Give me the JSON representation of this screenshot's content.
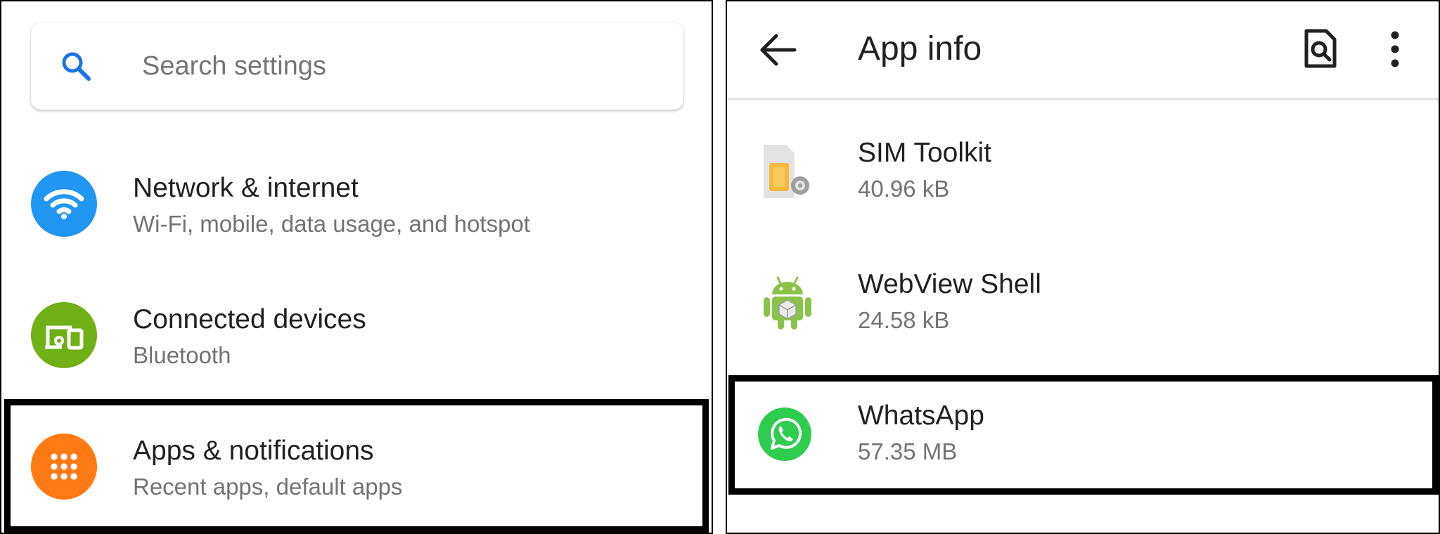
{
  "left_panel": {
    "search": {
      "placeholder": "Search settings",
      "icon": "search-icon",
      "icon_color": "#1a73e8"
    },
    "items": [
      {
        "title": "Network & internet",
        "subtitle": "Wi-Fi, mobile, data usage, and hotspot",
        "icon": "wifi-icon",
        "icon_color": "#2196f3"
      },
      {
        "title": "Connected devices",
        "subtitle": "Bluetooth",
        "icon": "devices-icon",
        "icon_color": "#6eb016"
      },
      {
        "title": "Apps & notifications",
        "subtitle": "Recent apps, default apps",
        "icon": "apps-grid-icon",
        "icon_color": "#ff7a14",
        "highlighted": true
      }
    ]
  },
  "right_panel": {
    "app_bar": {
      "title": "App info",
      "back_icon": "back-arrow-icon",
      "search_icon": "document-search-icon",
      "menu_icon": "more-vert-icon"
    },
    "apps": [
      {
        "name": "SIM Toolkit",
        "size": "40.96 kB",
        "icon": "sim-toolkit-icon"
      },
      {
        "name": "WebView Shell",
        "size": "24.58 kB",
        "icon": "android-webview-icon"
      },
      {
        "name": "WhatsApp",
        "size": "57.35 MB",
        "icon": "whatsapp-icon",
        "icon_color": "#2ecc4f",
        "highlighted": true
      }
    ]
  }
}
